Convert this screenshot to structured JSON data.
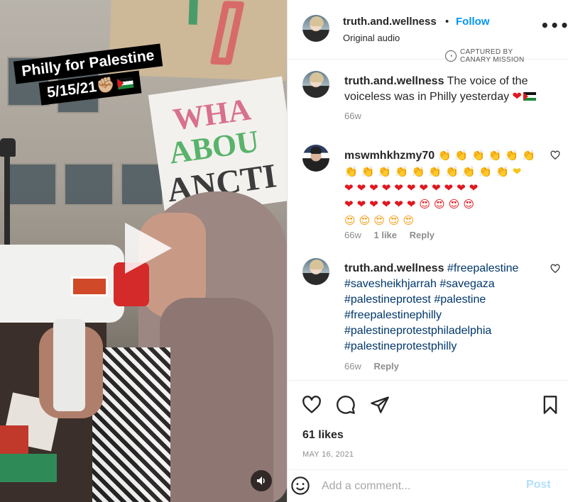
{
  "media": {
    "caption_line1": "Philly for Palestine",
    "caption_line2": "5/15/21",
    "caption_line2_emoji": "✊🏼",
    "sign_text_1": "WHA",
    "sign_text_2": "ABOU",
    "sign_text_3": "ANCTI",
    "play_icon": "play-icon",
    "audio_icon": "speaker-icon"
  },
  "header": {
    "username": "truth.and.wellness",
    "separator": "•",
    "follow_label": "Follow",
    "audio_label": "Original audio",
    "more_label": "•••",
    "captured_line1": "CAPTURED BY",
    "captured_line2": "CANARY MISSION"
  },
  "comments": [
    {
      "username": "truth.and.wellness",
      "text": "The voice of the voiceless was in Philly yesterday",
      "emoji": "❤",
      "age": "66w"
    },
    {
      "username": "mswmhkhzmy70",
      "emoji_line1": "👏👏👏👏👏👏",
      "emoji_line2": "👏👏👏👏👏👏👏👏👏👏❤",
      "emoji_line3": "❤❤❤❤❤❤❤❤❤❤❤",
      "emoji_line4": "❤❤❤❤❤❤😍😍😍😍",
      "emoji_line5": "😍😍😍😍😍",
      "age": "66w",
      "likes": "1 like",
      "reply_label": "Reply"
    },
    {
      "username": "truth.and.wellness",
      "hashtags": [
        "#freepalestine",
        "#savesheikhjarrah",
        "#savegaza",
        "#palestineprotest",
        "#palestine",
        "#freepalestinephilly",
        "#palestineprotestphiladelphia",
        "#palestineprotestphilly"
      ],
      "age": "66w",
      "reply_label": "Reply"
    }
  ],
  "footer": {
    "likes": "61 likes",
    "date": "MAY 16, 2021",
    "comment_placeholder": "Add a comment...",
    "post_label": "Post"
  },
  "colors": {
    "accent": "#0095f6",
    "hashtag": "#00376b",
    "muted": "#8e8e8e",
    "post_disabled": "#b2dffc"
  }
}
